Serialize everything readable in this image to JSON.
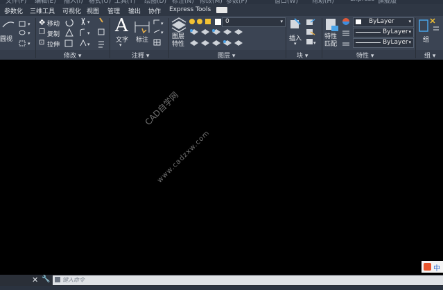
{
  "menubar_partial": [
    "文件(F)",
    "编辑(E)",
    "插入(I)",
    "格式(O)",
    "工具(T)",
    "绘图(D)",
    "标注(N)",
    "修改(M)",
    "参数(P)",
    "窗口(W)",
    "帮助(H)",
    "Express",
    "旗舰版"
  ],
  "tabs": [
    "参数化",
    "三维工具",
    "可视化",
    "视图",
    "管理",
    "输出",
    "协作",
    "Express Tools"
  ],
  "panels": {
    "modify": {
      "label": "修改 ▾",
      "move": "移动",
      "copy": "复制",
      "stretch": "拉伸"
    },
    "draw_partial": {
      "label": "圆视"
    },
    "annotate": {
      "label": "注释 ▾",
      "text": "文字",
      "dimension": "标注"
    },
    "layers": {
      "label": "图层 ▾",
      "layer_props": "图层\n特性",
      "current_layer": "0"
    },
    "block": {
      "label": "块 ▾",
      "insert": "插入"
    },
    "properties": {
      "label": "特性 ▾",
      "match": "特性\n匹配",
      "color": "ByLayer",
      "linetype": "ByLayer",
      "lineweight": "ByLayer"
    },
    "groups": {
      "label": "组 ▾",
      "group": "组"
    }
  },
  "watermark": {
    "line1": "CAD自学网",
    "line2": "www.cadzxw.com"
  },
  "command": {
    "placeholder": "键入命令"
  },
  "ime": {
    "label": "中"
  }
}
